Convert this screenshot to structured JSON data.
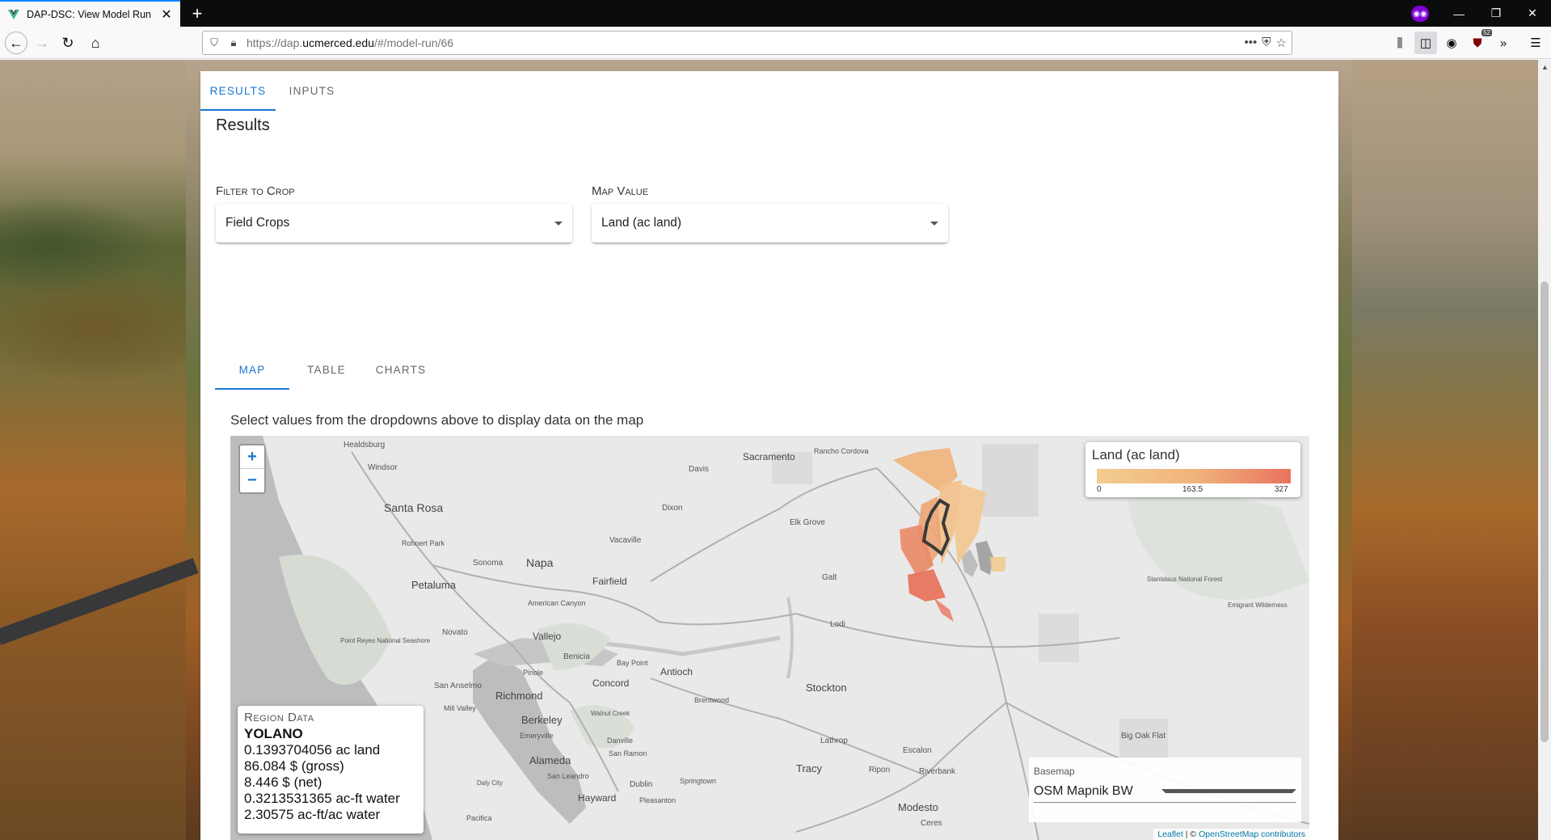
{
  "browser": {
    "tab_title": "DAP-DSC: View Model Run",
    "new_tab": "+",
    "url_prefix": "https://dap.",
    "url_domain": "ucmerced.edu",
    "url_path": "/#/model-run/66",
    "addon_badge": "52",
    "icons": [
      "back-icon",
      "forward-icon",
      "reload-icon",
      "home-icon",
      "shield-icon",
      "lock-icon",
      "ellipsis-icon",
      "pocket-icon",
      "star-icon",
      "library-icon",
      "sidebar-icon",
      "account-icon",
      "ublock-icon",
      "overflow-icon",
      "hamburger-menu-icon"
    ]
  },
  "page": {
    "main_tabs": [
      {
        "label": "Results",
        "active": true
      },
      {
        "label": "Inputs",
        "active": false
      }
    ],
    "results_title": "Results",
    "filter": {
      "label": "Filter to Crop",
      "value": "Field Crops"
    },
    "map_value": {
      "label": "Map Value",
      "value": "Land (ac land)"
    },
    "view_tabs": [
      {
        "label": "Map",
        "active": true
      },
      {
        "label": "Table",
        "active": false
      },
      {
        "label": "Charts",
        "active": false
      }
    ],
    "instructions": "Select values from the dropdowns above to display data on the map"
  },
  "map": {
    "zoom_in": "+",
    "zoom_out": "−",
    "legend": {
      "title": "Land (ac land)",
      "min": "0",
      "mid": "163.5",
      "max": "327",
      "colors": [
        "#f2cc8f",
        "#e8735f"
      ]
    },
    "region": {
      "heading": "Region Data",
      "name": "YOLANO",
      "lines": [
        "0.1393704056 ac land",
        "86.084 $ (gross)",
        "8.446 $ (net)",
        "0.3213531365 ac-ft water",
        "2.30575 ac-ft/ac water"
      ]
    },
    "basemap": {
      "label": "Basemap",
      "value": "OSM Mapnik BW"
    },
    "attribution": {
      "leaflet": "Leaflet",
      "sep": " | © ",
      "osm": "OpenStreetMap contributors"
    },
    "places": [
      "Healdsburg",
      "Windsor",
      "Santa Rosa",
      "Rohnert Park",
      "Sonoma",
      "Petaluma",
      "Napa",
      "American Canyon",
      "Novato",
      "Point Reyes National Seashore",
      "Vallejo",
      "Benicia",
      "Pinole",
      "San Anselmo",
      "Mill Valley",
      "Richmond",
      "Berkeley",
      "Emeryville",
      "Alameda",
      "San Leandro",
      "Daly City",
      "Pacifica",
      "Hayward",
      "Dublin",
      "Pleasanton",
      "Concord",
      "Walnut Creek",
      "Danville",
      "San Ramon",
      "Bay Point",
      "Antioch",
      "Brentwood",
      "Fairfield",
      "Vacaville",
      "Dixon",
      "Davis",
      "Sacramento",
      "Rancho Cordova",
      "Elk Grove",
      "Galt",
      "Lodi",
      "Stockton",
      "Lathrop",
      "Tracy",
      "Ripon",
      "Escalon",
      "Riverbank",
      "Modesto",
      "Ceres",
      "Springtown",
      "Big Oak Flat",
      "Stanislaus National Forest",
      "Emigrant Wilderness"
    ]
  }
}
